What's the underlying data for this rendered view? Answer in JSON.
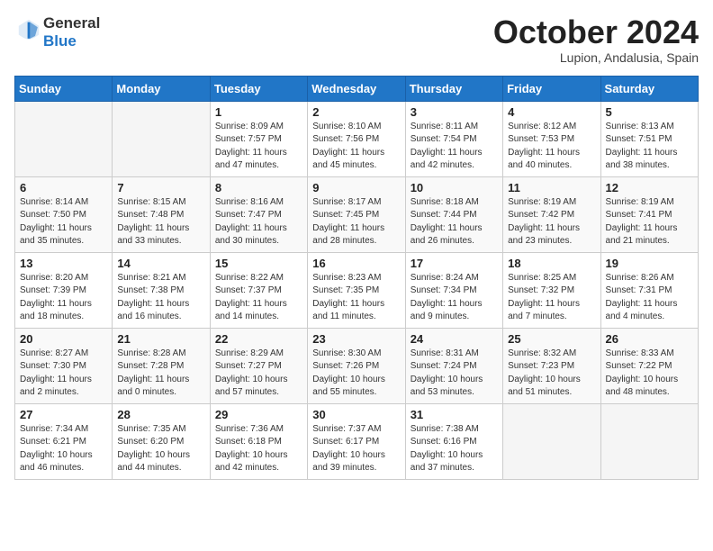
{
  "header": {
    "logo_general": "General",
    "logo_blue": "Blue",
    "month_title": "October 2024",
    "subtitle": "Lupion, Andalusia, Spain"
  },
  "weekdays": [
    "Sunday",
    "Monday",
    "Tuesday",
    "Wednesday",
    "Thursday",
    "Friday",
    "Saturday"
  ],
  "weeks": [
    [
      {
        "day": "",
        "info": ""
      },
      {
        "day": "",
        "info": ""
      },
      {
        "day": "1",
        "info": "Sunrise: 8:09 AM\nSunset: 7:57 PM\nDaylight: 11 hours and 47 minutes."
      },
      {
        "day": "2",
        "info": "Sunrise: 8:10 AM\nSunset: 7:56 PM\nDaylight: 11 hours and 45 minutes."
      },
      {
        "day": "3",
        "info": "Sunrise: 8:11 AM\nSunset: 7:54 PM\nDaylight: 11 hours and 42 minutes."
      },
      {
        "day": "4",
        "info": "Sunrise: 8:12 AM\nSunset: 7:53 PM\nDaylight: 11 hours and 40 minutes."
      },
      {
        "day": "5",
        "info": "Sunrise: 8:13 AM\nSunset: 7:51 PM\nDaylight: 11 hours and 38 minutes."
      }
    ],
    [
      {
        "day": "6",
        "info": "Sunrise: 8:14 AM\nSunset: 7:50 PM\nDaylight: 11 hours and 35 minutes."
      },
      {
        "day": "7",
        "info": "Sunrise: 8:15 AM\nSunset: 7:48 PM\nDaylight: 11 hours and 33 minutes."
      },
      {
        "day": "8",
        "info": "Sunrise: 8:16 AM\nSunset: 7:47 PM\nDaylight: 11 hours and 30 minutes."
      },
      {
        "day": "9",
        "info": "Sunrise: 8:17 AM\nSunset: 7:45 PM\nDaylight: 11 hours and 28 minutes."
      },
      {
        "day": "10",
        "info": "Sunrise: 8:18 AM\nSunset: 7:44 PM\nDaylight: 11 hours and 26 minutes."
      },
      {
        "day": "11",
        "info": "Sunrise: 8:19 AM\nSunset: 7:42 PM\nDaylight: 11 hours and 23 minutes."
      },
      {
        "day": "12",
        "info": "Sunrise: 8:19 AM\nSunset: 7:41 PM\nDaylight: 11 hours and 21 minutes."
      }
    ],
    [
      {
        "day": "13",
        "info": "Sunrise: 8:20 AM\nSunset: 7:39 PM\nDaylight: 11 hours and 18 minutes."
      },
      {
        "day": "14",
        "info": "Sunrise: 8:21 AM\nSunset: 7:38 PM\nDaylight: 11 hours and 16 minutes."
      },
      {
        "day": "15",
        "info": "Sunrise: 8:22 AM\nSunset: 7:37 PM\nDaylight: 11 hours and 14 minutes."
      },
      {
        "day": "16",
        "info": "Sunrise: 8:23 AM\nSunset: 7:35 PM\nDaylight: 11 hours and 11 minutes."
      },
      {
        "day": "17",
        "info": "Sunrise: 8:24 AM\nSunset: 7:34 PM\nDaylight: 11 hours and 9 minutes."
      },
      {
        "day": "18",
        "info": "Sunrise: 8:25 AM\nSunset: 7:32 PM\nDaylight: 11 hours and 7 minutes."
      },
      {
        "day": "19",
        "info": "Sunrise: 8:26 AM\nSunset: 7:31 PM\nDaylight: 11 hours and 4 minutes."
      }
    ],
    [
      {
        "day": "20",
        "info": "Sunrise: 8:27 AM\nSunset: 7:30 PM\nDaylight: 11 hours and 2 minutes."
      },
      {
        "day": "21",
        "info": "Sunrise: 8:28 AM\nSunset: 7:28 PM\nDaylight: 11 hours and 0 minutes."
      },
      {
        "day": "22",
        "info": "Sunrise: 8:29 AM\nSunset: 7:27 PM\nDaylight: 10 hours and 57 minutes."
      },
      {
        "day": "23",
        "info": "Sunrise: 8:30 AM\nSunset: 7:26 PM\nDaylight: 10 hours and 55 minutes."
      },
      {
        "day": "24",
        "info": "Sunrise: 8:31 AM\nSunset: 7:24 PM\nDaylight: 10 hours and 53 minutes."
      },
      {
        "day": "25",
        "info": "Sunrise: 8:32 AM\nSunset: 7:23 PM\nDaylight: 10 hours and 51 minutes."
      },
      {
        "day": "26",
        "info": "Sunrise: 8:33 AM\nSunset: 7:22 PM\nDaylight: 10 hours and 48 minutes."
      }
    ],
    [
      {
        "day": "27",
        "info": "Sunrise: 7:34 AM\nSunset: 6:21 PM\nDaylight: 10 hours and 46 minutes."
      },
      {
        "day": "28",
        "info": "Sunrise: 7:35 AM\nSunset: 6:20 PM\nDaylight: 10 hours and 44 minutes."
      },
      {
        "day": "29",
        "info": "Sunrise: 7:36 AM\nSunset: 6:18 PM\nDaylight: 10 hours and 42 minutes."
      },
      {
        "day": "30",
        "info": "Sunrise: 7:37 AM\nSunset: 6:17 PM\nDaylight: 10 hours and 39 minutes."
      },
      {
        "day": "31",
        "info": "Sunrise: 7:38 AM\nSunset: 6:16 PM\nDaylight: 10 hours and 37 minutes."
      },
      {
        "day": "",
        "info": ""
      },
      {
        "day": "",
        "info": ""
      }
    ]
  ]
}
